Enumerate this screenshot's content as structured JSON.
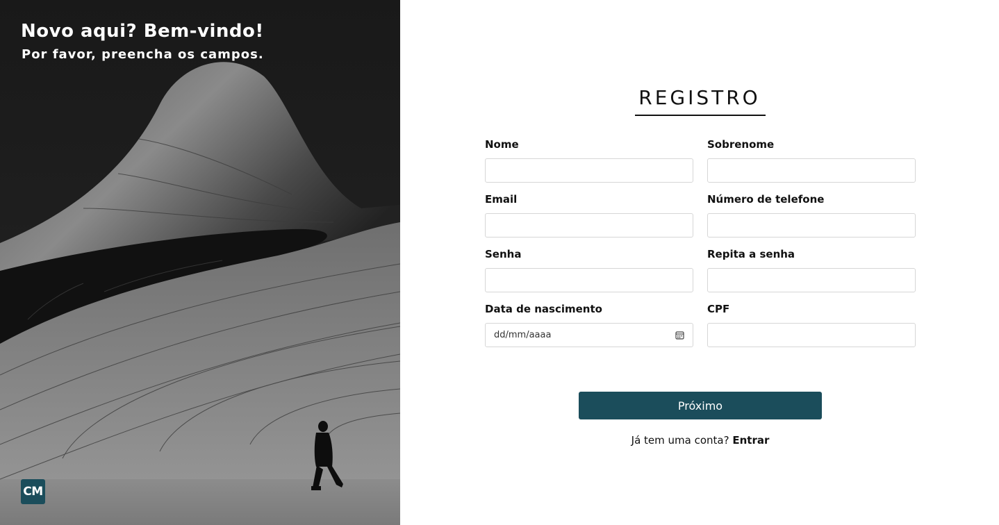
{
  "hero": {
    "title": "Novo aqui? Bem-vindo!",
    "subtitle": "Por favor, preencha os campos.",
    "logo_text": "CM"
  },
  "form": {
    "title": "REGISTRO",
    "fields": {
      "first_name": {
        "label": "Nome",
        "value": ""
      },
      "last_name": {
        "label": "Sobrenome",
        "value": ""
      },
      "email": {
        "label": "Email",
        "value": ""
      },
      "phone": {
        "label": "Número de telefone",
        "value": ""
      },
      "password": {
        "label": "Senha",
        "value": ""
      },
      "password_repeat": {
        "label": "Repita a senha",
        "value": ""
      },
      "birth_date": {
        "label": "Data de nascimento",
        "placeholder": "dd/mm/aaaa",
        "icon": "calendar-icon"
      },
      "cpf": {
        "label": "CPF",
        "value": ""
      }
    },
    "next_label": "Próximo",
    "login_prompt": "Já tem uma conta?",
    "login_link": "Entrar"
  },
  "colors": {
    "accent": "#1b4d5b",
    "hero_bg": "#1c1c1c",
    "text": "#111111",
    "input_border": "#d6d6d6"
  }
}
